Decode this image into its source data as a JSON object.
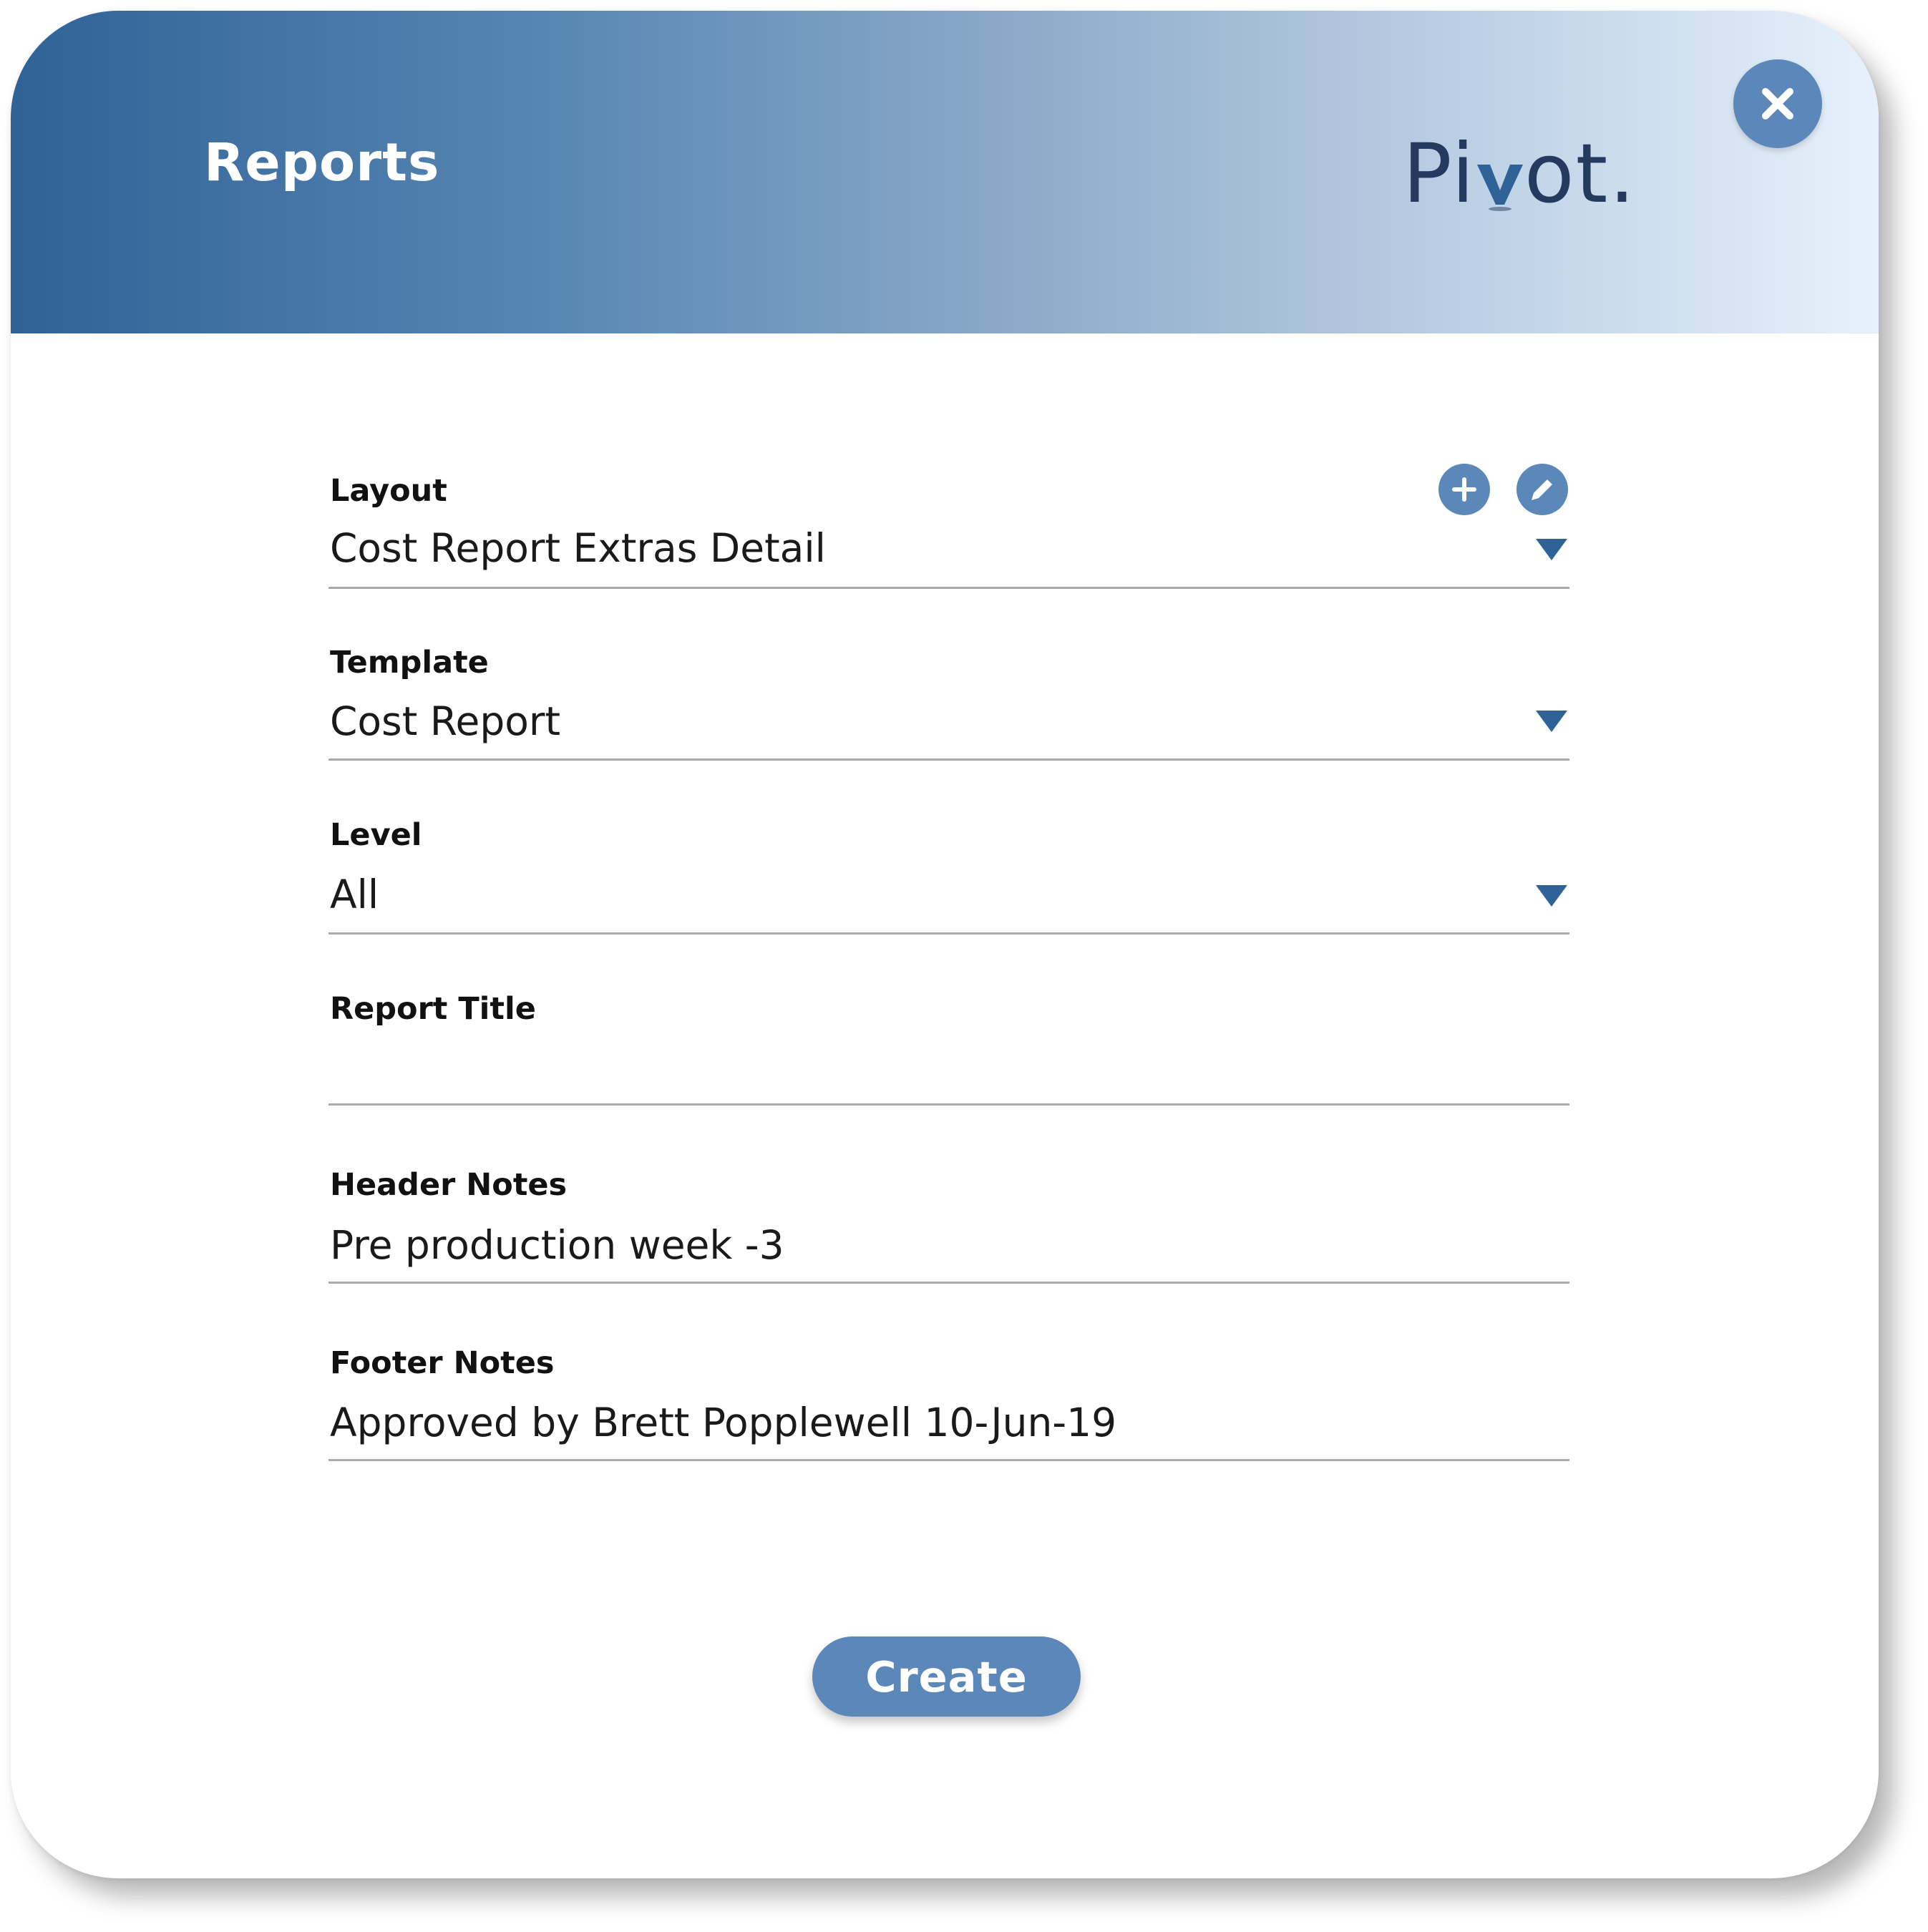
{
  "dialog": {
    "title": "Reports",
    "logo_text_before": "Pi",
    "logo_text_after": "ot."
  },
  "icons": {
    "close": "close-icon",
    "add": "plus-icon",
    "edit": "pencil-icon",
    "dropdown": "triangle-down-icon"
  },
  "colors": {
    "header_start": "#2f6296",
    "header_end": "#e6f1fb",
    "accent": "#5b87b9",
    "logo": "#243a5e"
  },
  "form": {
    "layout": {
      "label": "Layout",
      "value": "Cost Report Extras Detail"
    },
    "template": {
      "label": "Template",
      "value": "Cost Report"
    },
    "level": {
      "label": "Level",
      "value": "All"
    },
    "report_title": {
      "label": "Report Title",
      "value": ""
    },
    "header_notes": {
      "label": "Header Notes",
      "value": "Pre production week -3"
    },
    "footer_notes": {
      "label": "Footer Notes",
      "value": "Approved by Brett Popplewell 10-Jun-19"
    }
  },
  "actions": {
    "create_label": "Create"
  }
}
